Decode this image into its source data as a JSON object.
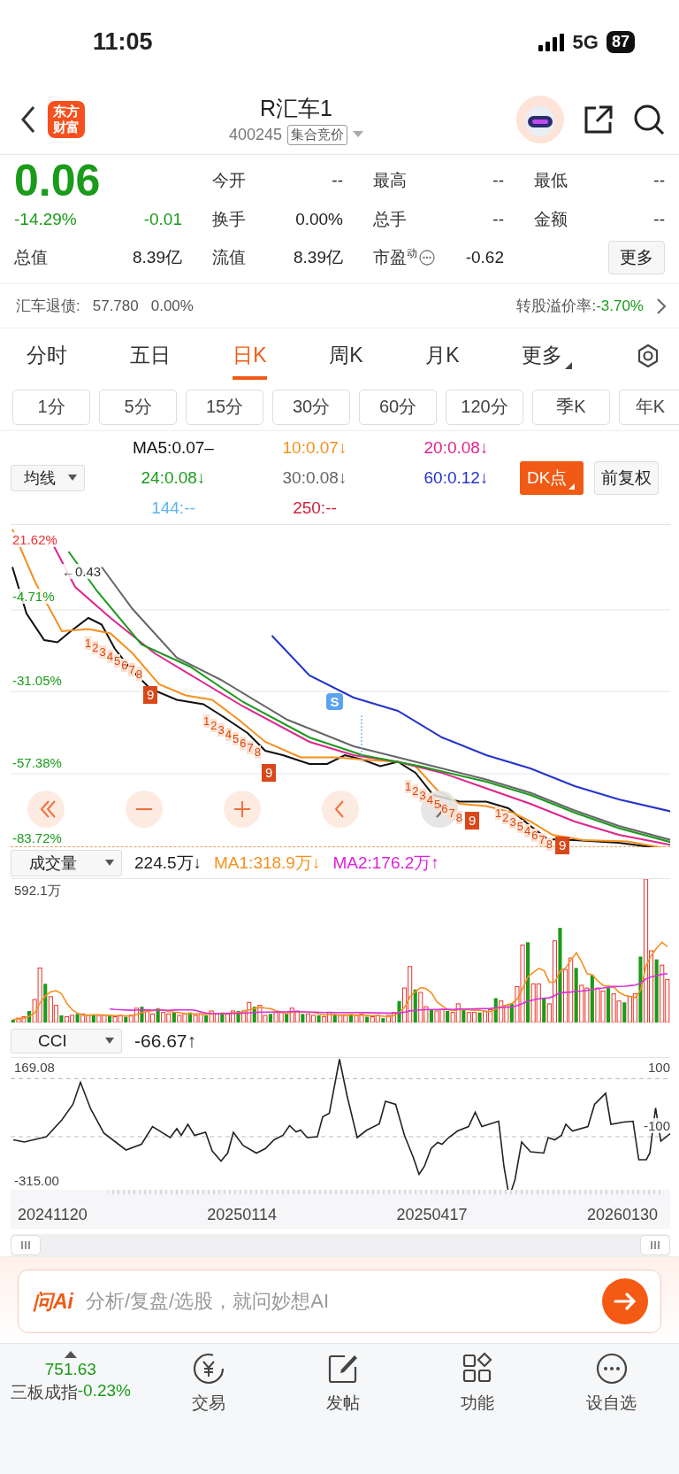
{
  "status_bar": {
    "time": "11:05",
    "network": "5G",
    "battery": "87"
  },
  "header": {
    "logo": "东方财富",
    "title": "R汇车1",
    "code": "400245",
    "tag": "集合竞价"
  },
  "quote": {
    "price": "0.06",
    "change_pct": "-14.29%",
    "change": "-0.01",
    "stats": [
      {
        "label": "今开",
        "value": "--"
      },
      {
        "label": "最高",
        "value": "--"
      },
      {
        "label": "最低",
        "value": "--"
      },
      {
        "label": "换手",
        "value": "0.00%"
      },
      {
        "label": "总手",
        "value": "--"
      },
      {
        "label": "金额",
        "value": "--"
      }
    ],
    "total_label": "总值",
    "total_value": "8.39亿",
    "extra": [
      {
        "label": "流值",
        "value": "8.39亿"
      },
      {
        "label": "市盈$^{动}$",
        "value": "-0.62"
      }
    ],
    "more_button": "更多"
  },
  "bond": {
    "label": "汇车退债:",
    "price": "57.780",
    "pct": "0.00%",
    "premium_label": "转股溢价率:",
    "premium_value": "-3.70%"
  },
  "tabs": [
    {
      "label": "分时",
      "selected": false,
      "kind": "tab"
    },
    {
      "label": "五日",
      "selected": false,
      "kind": "tab"
    },
    {
      "label": "日K",
      "selected": true,
      "kind": "tab"
    },
    {
      "label": "周K",
      "selected": false,
      "kind": "tab"
    },
    {
      "label": "月K",
      "selected": false,
      "kind": "tab"
    },
    {
      "label": "更多",
      "selected": false,
      "kind": "menu"
    }
  ],
  "periods": [
    "1分",
    "5分",
    "15分",
    "30分",
    "60分",
    "120分",
    "季K",
    "年K"
  ],
  "ma_legend": {
    "selector": "均线",
    "items": [
      {
        "text": "MA5:0.07–",
        "color": "#111111"
      },
      {
        "text": "10:0.07↓",
        "color": "#f5901e"
      },
      {
        "text": "20:0.08↓",
        "color": "#e0248c"
      },
      {
        "text": "24:0.08↓",
        "color": "#1a9b1a"
      },
      {
        "text": "30:0.08↓",
        "color": "#666666"
      },
      {
        "text": "60:0.12↓",
        "color": "#2233cc"
      },
      {
        "text": "144:--",
        "color": "#5ab4f0"
      },
      {
        "text": "250:--",
        "color": "#d3203a"
      }
    ],
    "dk_button": "DK点",
    "adjust_button": "前复权"
  },
  "kline": {
    "y_labels": [
      {
        "text": "21.62%",
        "color": "#f03030"
      },
      {
        "text": "-4.71%",
        "color": "#1a9b1a"
      },
      {
        "text": "-31.05%",
        "color": "#1a9b1a"
      },
      {
        "text": "-57.38%",
        "color": "#1a9b1a"
      },
      {
        "text": "-83.72%",
        "color": "#1a9b1a"
      }
    ],
    "price_tag": "←0.43",
    "signal": "S",
    "td_counts": [
      {
        "digits": "12345678",
        "mark": "9"
      },
      {
        "digits": "12345678",
        "mark": "9"
      },
      {
        "digits": "12345678",
        "mark": "9"
      },
      {
        "digits": "12354678",
        "mark": "9"
      }
    ]
  },
  "volume": {
    "selector": "成交量",
    "value": "224.5万↓",
    "ma1": "MA1:318.9万↓",
    "ma2": "MA2:176.2万↑",
    "max_label": "592.1万"
  },
  "cci": {
    "selector": "CCI",
    "value": "-66.67↑",
    "max_label": "169.08",
    "min_label": "-315.00",
    "levels": [
      "100",
      "-100"
    ]
  },
  "dates": [
    "20241120",
    "20250114",
    "20250417",
    "20260130"
  ],
  "ai_bar": {
    "brand": "问Ai",
    "placeholder": "分析/复盘/选股，就问妙想AI"
  },
  "bottom_nav": {
    "index_value": "751.63",
    "index_name": "三板成指",
    "index_change": "-0.23%",
    "items": [
      "交易",
      "发帖",
      "功能",
      "设自选"
    ]
  }
}
